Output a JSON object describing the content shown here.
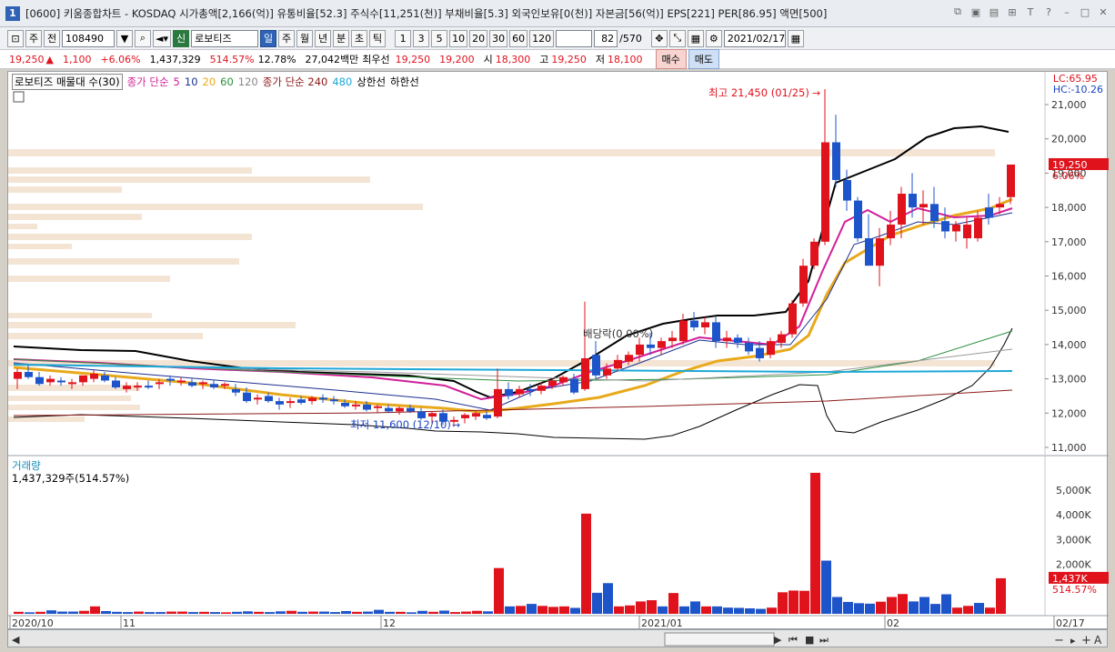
{
  "window": {
    "num": "1",
    "title": "[0600] 키움종합차트 - KOSDAQ 시가총액[2,166(억)] 유통비율[52.3] 주식수[11,251(천)] 부채비율[5.3] 외국인보유[0(천)] 자본금[56(억)] EPS[221] PER[86.95] 액면[500]"
  },
  "toolbar": {
    "period_day": "일",
    "period_week": "주",
    "period_month": "월",
    "period_year": "년",
    "period_min": "분",
    "period_sec": "초",
    "period_tick": "틱",
    "stock_type": "주",
    "prev_btn": "전",
    "code": "108490",
    "new_badge": "신",
    "stock_name": "로보티즈",
    "intervals": [
      "1",
      "3",
      "5",
      "10",
      "20",
      "30",
      "60",
      "120"
    ],
    "count": "82",
    "count_total": "/570",
    "date": "2021/02/17"
  },
  "info": {
    "price": "19,250",
    "arrow": "▲",
    "change": "1,100",
    "change_pct": "+6.06%",
    "volume": "1,437,329",
    "volume_ratio": "514.57%",
    "turnover": "12.78%",
    "amount": "27,042백만",
    "best_label": "최우선",
    "best_ask": "19,250",
    "best_bid": "19,200",
    "open_label": "시",
    "open": "18,300",
    "high_label": "고",
    "high": "19,250",
    "low_label": "저",
    "low": "18,100",
    "buy_label": "매수",
    "sell_label": "매도"
  },
  "legend": {
    "profile": "로보티즈 매물대 수(30)",
    "ma_title": "종가 단순",
    "ma5": "5",
    "ma10": "10",
    "ma20": "20",
    "ma60": "60",
    "ma120": "120",
    "ma240_title": "종가 단순 240",
    "ma480": "480",
    "upper": "상한선",
    "lower": "하한선"
  },
  "lc": {
    "lc": "LC:65.95",
    "hc": "HC:-10.26"
  },
  "price_axis": [
    "21,000",
    "20,000",
    "19,000",
    "18,000",
    "17,000",
    "16,000",
    "15,000",
    "14,000",
    "13,000",
    "12,000",
    "11,000"
  ],
  "current_price_tag": "19,250",
  "current_pct_tag": "6.06%",
  "annotations": {
    "high": "최고 21,450 (01/25)",
    "low": "최저 11,600 (12/10)",
    "dividend": "배당락(0.00%)"
  },
  "volume": {
    "title": "거래량",
    "summary": "1,437,329주(514.57%)",
    "axis": [
      "5,000K",
      "4,000K",
      "3,000K",
      "2,000K"
    ],
    "tag": "1,437K",
    "tag_pct": "514.57%"
  },
  "date_axis": [
    "2020/10",
    "11",
    "12",
    "2021/01",
    "02",
    "02/17"
  ],
  "colors": {
    "up": "#e0131d",
    "down": "#1d54c9",
    "ma5": "#d21f9a",
    "ma10": "#1b2f8e",
    "ma20": "#e8a91b",
    "band": "#000000"
  }
}
